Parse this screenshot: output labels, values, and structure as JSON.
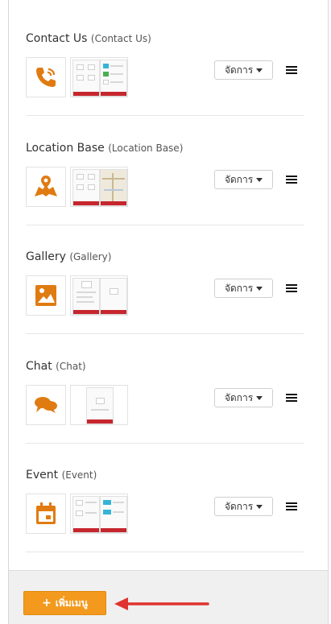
{
  "menu_items": [
    {
      "title": "Contact Us",
      "subtitle": "(Contact Us)",
      "icon": "phone-icon",
      "manage_label": "จัดการ"
    },
    {
      "title": "Location Base",
      "subtitle": "(Location Base)",
      "icon": "map-pin-icon",
      "manage_label": "จัดการ"
    },
    {
      "title": "Gallery",
      "subtitle": "(Gallery)",
      "icon": "image-icon",
      "manage_label": "จัดการ"
    },
    {
      "title": "Chat",
      "subtitle": "(Chat)",
      "icon": "chat-bubbles-icon",
      "manage_label": "จัดการ"
    },
    {
      "title": "Event",
      "subtitle": "(Event)",
      "icon": "calendar-icon",
      "manage_label": "จัดการ"
    }
  ],
  "footer": {
    "add_menu_label": "เพิ่มเมนู"
  },
  "colors": {
    "accent": "#f39a1e",
    "icon": "#e07b12",
    "preview_bar": "#c6262e",
    "arrow": "#e0332f"
  }
}
